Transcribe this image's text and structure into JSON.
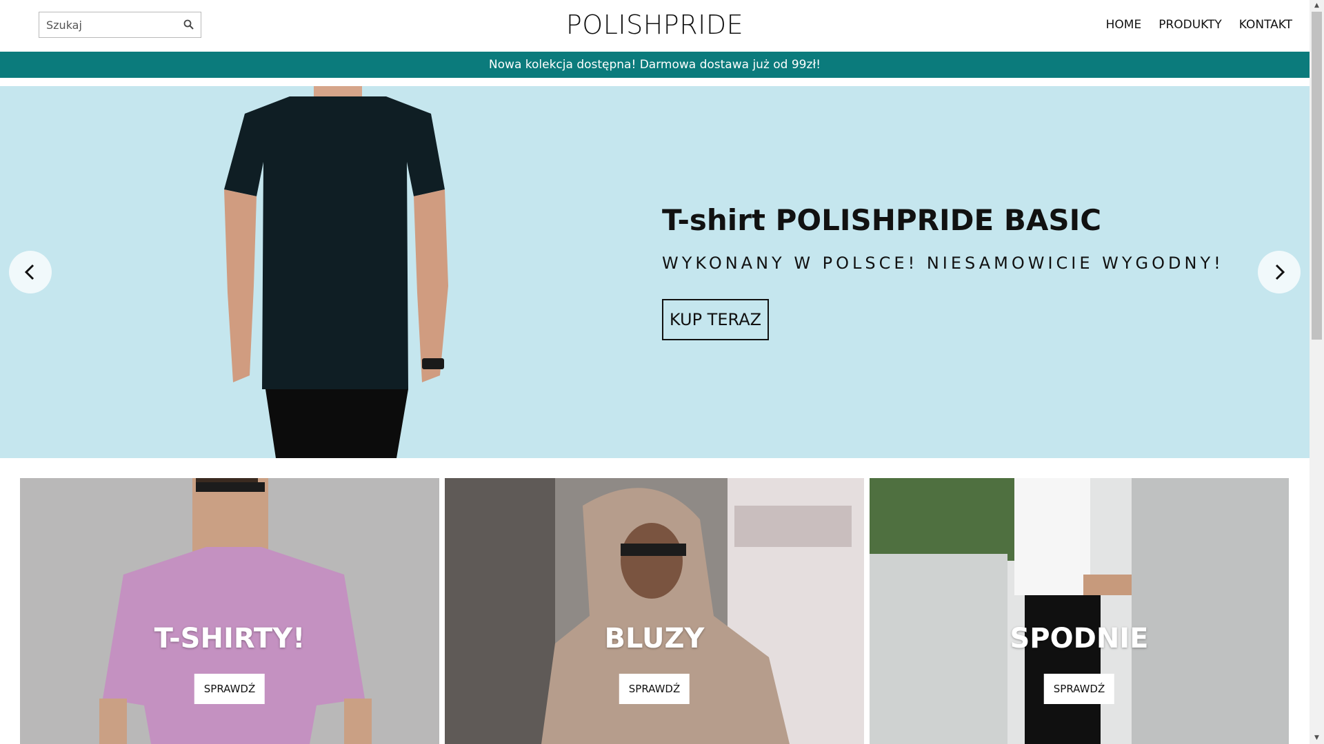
{
  "header": {
    "search_placeholder": "Szukaj",
    "logo": "POLISHPRIDE",
    "nav": [
      "HOME",
      "PRODUKTY",
      "KONTAKT"
    ]
  },
  "announcement": "Nowa kolekcja dostępna! Darmowa dostawa już od 99zł!",
  "hero": {
    "title": "T-shirt POLISHPRIDE BASIC",
    "subtitle": "WYKONANY W POLSCE! NIESAMOWICIE WYGODNY!",
    "cta": "KUP TERAZ",
    "background": "#c5e6ee"
  },
  "categories": [
    {
      "title": "T-SHIRTY!",
      "button": "SPRAWDŹ"
    },
    {
      "title": "BLUZY",
      "button": "SPRAWDŹ"
    },
    {
      "title": "SPODNIE",
      "button": "SPRAWDŹ"
    }
  ],
  "colors": {
    "announcement_bg": "#0b7b7c",
    "text": "#111111"
  },
  "icons": [
    "search-icon",
    "chevron-left-icon",
    "chevron-right-icon"
  ]
}
